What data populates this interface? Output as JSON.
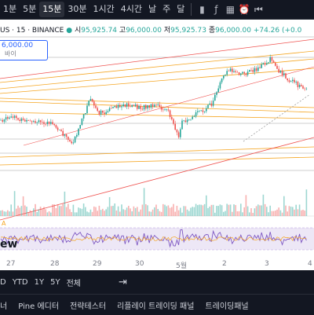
{
  "toolbar": {
    "timeframes": [
      "1분",
      "5분",
      "15분",
      "30분",
      "1시간",
      "4시간",
      "날",
      "주",
      "달"
    ],
    "active_timeframe": "15분"
  },
  "legend": {
    "symbol": "US · 15 · BINANCE",
    "open_label": "시",
    "open": "95,925.74",
    "high_label": "고",
    "high": "96,000.00",
    "low_label": "저",
    "low": "95,925.73",
    "close_label": "종",
    "close": "96,000.00",
    "change": "+74.26 (+0.0"
  },
  "price_box": {
    "price": "6,000.00",
    "sub": "바이"
  },
  "watermark": "ew",
  "rsi_label": "A",
  "dates": [
    "27",
    "28",
    "29",
    "30",
    "5월",
    "2",
    "3",
    "4"
  ],
  "ranges": [
    "D",
    "YTD",
    "1Y",
    "5Y",
    "전체"
  ],
  "bottom_tabs": [
    "너",
    "Pine 에디터",
    "전략테스터",
    "리플레이 트레이딩 패널",
    "트레이딩패널"
  ],
  "colors": {
    "up": "#26a69a",
    "down": "#ef5350",
    "accent": "#2962ff",
    "trendline_orange": "#f5a623",
    "trendline_red": "#ef5350",
    "rsi": "#7e57c2"
  }
}
